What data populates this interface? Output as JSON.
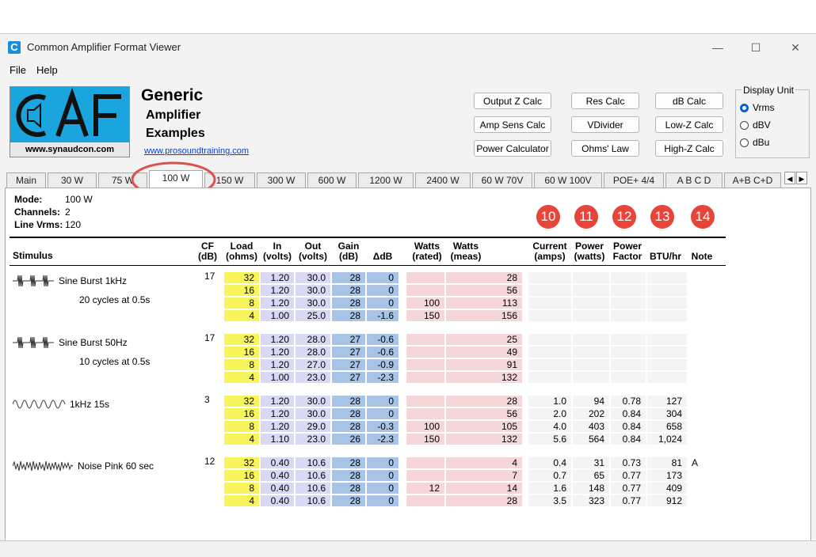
{
  "window": {
    "title": "Common Amplifier Format Viewer",
    "icon_letter": "C",
    "controls": {
      "minimize": "—",
      "maximize": "☐",
      "close": "✕"
    }
  },
  "menu": [
    "File",
    "Help"
  ],
  "logo": {
    "text": "CAF",
    "url": "www.synaudcon.com"
  },
  "brand": {
    "title": "Generic",
    "line1": "Amplifier",
    "line2": "Examples",
    "link": "www.prosoundtraining.com"
  },
  "buttons": {
    "output_z": "Output Z Calc",
    "res": "Res Calc",
    "db": "dB Calc",
    "amp_sens": "Amp Sens Calc",
    "vdivider": "VDivider",
    "low_z": "Low-Z Calc",
    "power": "Power Calculator",
    "ohms": "Ohms' Law",
    "high_z": "High-Z Calc"
  },
  "display_unit": {
    "legend": "Display Unit",
    "options": [
      "Vrms",
      "dBV",
      "dBu"
    ],
    "selected": "Vrms"
  },
  "tabs": [
    "Main",
    "30 W",
    "75 W",
    "100 W",
    "150 W",
    "300 W",
    "600 W",
    "1200 W",
    "2400 W",
    "60 W 70V",
    "60 W 100V",
    "POE+ 4/4",
    "A B C D",
    "A+B C+D"
  ],
  "active_tab": "100 W",
  "mode": {
    "mode_label": "Mode:",
    "mode_value": "100 W",
    "channels_label": "Channels:",
    "channels_value": "2",
    "line_label": "Line Vrms:",
    "line_value": "120"
  },
  "badges": [
    "10",
    "11",
    "12",
    "13",
    "14"
  ],
  "headers": {
    "stimulus": "Stimulus",
    "cf": [
      "CF",
      "(dB)"
    ],
    "load": [
      "Load",
      "(ohms)"
    ],
    "in": [
      "In",
      "(volts)"
    ],
    "out": [
      "Out",
      "(volts)"
    ],
    "gain": [
      "Gain",
      "(dB)"
    ],
    "ddb": [
      "",
      "ΔdB"
    ],
    "watts_rated": [
      "Watts",
      "(rated)"
    ],
    "watts_meas": [
      "Watts",
      "(meas)"
    ],
    "current": [
      "Current",
      "(amps)"
    ],
    "power": [
      "Power",
      "(watts)"
    ],
    "pf": [
      "Power",
      "Factor"
    ],
    "btu": [
      "",
      "BTU/hr"
    ],
    "note": [
      "",
      "Note"
    ]
  },
  "groups": [
    {
      "name": "Sine Burst 1kHz",
      "sub": "20 cycles at 0.5s",
      "wave": "burst",
      "cf": "17",
      "rows": [
        {
          "load": "32",
          "in": "1.20",
          "out": "30.0",
          "gain": "28",
          "ddb": "0",
          "rated": "",
          "meas": "28",
          "current": "",
          "power": "",
          "pf": "",
          "btu": "",
          "note": ""
        },
        {
          "load": "16",
          "in": "1.20",
          "out": "30.0",
          "gain": "28",
          "ddb": "0",
          "rated": "",
          "meas": "56",
          "current": "",
          "power": "",
          "pf": "",
          "btu": "",
          "note": ""
        },
        {
          "load": "8",
          "in": "1.20",
          "out": "30.0",
          "gain": "28",
          "ddb": "0",
          "rated": "100",
          "meas": "113",
          "current": "",
          "power": "",
          "pf": "",
          "btu": "",
          "note": ""
        },
        {
          "load": "4",
          "in": "1.00",
          "out": "25.0",
          "gain": "28",
          "ddb": "-1.6",
          "rated": "150",
          "meas": "156",
          "current": "",
          "power": "",
          "pf": "",
          "btu": "",
          "note": ""
        }
      ]
    },
    {
      "name": "Sine Burst 50Hz",
      "sub": "10 cycles at 0.5s",
      "wave": "burst",
      "cf": "17",
      "rows": [
        {
          "load": "32",
          "in": "1.20",
          "out": "28.0",
          "gain": "27",
          "ddb": "-0.6",
          "rated": "",
          "meas": "25",
          "current": "",
          "power": "",
          "pf": "",
          "btu": "",
          "note": ""
        },
        {
          "load": "16",
          "in": "1.20",
          "out": "28.0",
          "gain": "27",
          "ddb": "-0.6",
          "rated": "",
          "meas": "49",
          "current": "",
          "power": "",
          "pf": "",
          "btu": "",
          "note": ""
        },
        {
          "load": "8",
          "in": "1.20",
          "out": "27.0",
          "gain": "27",
          "ddb": "-0.9",
          "rated": "",
          "meas": "91",
          "current": "",
          "power": "",
          "pf": "",
          "btu": "",
          "note": ""
        },
        {
          "load": "4",
          "in": "1.00",
          "out": "23.0",
          "gain": "27",
          "ddb": "-2.3",
          "rated": "",
          "meas": "132",
          "current": "",
          "power": "",
          "pf": "",
          "btu": "",
          "note": ""
        }
      ]
    },
    {
      "name": "1kHz 15s",
      "sub": "",
      "wave": "sine",
      "cf": "3",
      "rows": [
        {
          "load": "32",
          "in": "1.20",
          "out": "30.0",
          "gain": "28",
          "ddb": "0",
          "rated": "",
          "meas": "28",
          "current": "1.0",
          "power": "94",
          "pf": "0.78",
          "btu": "127",
          "note": ""
        },
        {
          "load": "16",
          "in": "1.20",
          "out": "30.0",
          "gain": "28",
          "ddb": "0",
          "rated": "",
          "meas": "56",
          "current": "2.0",
          "power": "202",
          "pf": "0.84",
          "btu": "304",
          "note": ""
        },
        {
          "load": "8",
          "in": "1.20",
          "out": "29.0",
          "gain": "28",
          "ddb": "-0.3",
          "rated": "100",
          "meas": "105",
          "current": "4.0",
          "power": "403",
          "pf": "0.84",
          "btu": "658",
          "note": ""
        },
        {
          "load": "4",
          "in": "1.10",
          "out": "23.0",
          "gain": "26",
          "ddb": "-2.3",
          "rated": "150",
          "meas": "132",
          "current": "5.6",
          "power": "564",
          "pf": "0.84",
          "btu": "1,024",
          "note": ""
        }
      ]
    },
    {
      "name": "Noise Pink 60 sec",
      "sub": "",
      "wave": "noise",
      "cf": "12",
      "rows": [
        {
          "load": "32",
          "in": "0.40",
          "out": "10.6",
          "gain": "28",
          "ddb": "0",
          "rated": "",
          "meas": "4",
          "current": "0.4",
          "power": "31",
          "pf": "0.73",
          "btu": "81",
          "note": "A"
        },
        {
          "load": "16",
          "in": "0.40",
          "out": "10.6",
          "gain": "28",
          "ddb": "0",
          "rated": "",
          "meas": "7",
          "current": "0.7",
          "power": "65",
          "pf": "0.77",
          "btu": "173",
          "note": ""
        },
        {
          "load": "8",
          "in": "0.40",
          "out": "10.6",
          "gain": "28",
          "ddb": "0",
          "rated": "12",
          "meas": "14",
          "current": "1.6",
          "power": "148",
          "pf": "0.77",
          "btu": "409",
          "note": ""
        },
        {
          "load": "4",
          "in": "0.40",
          "out": "10.6",
          "gain": "28",
          "ddb": "0",
          "rated": "",
          "meas": "28",
          "current": "3.5",
          "power": "323",
          "pf": "0.77",
          "btu": "912",
          "note": ""
        }
      ]
    }
  ],
  "colors": {
    "highlight_circle": "#d9534f",
    "badge": "#e8453a",
    "load_cell": "#f8f55a",
    "in_out_cell": "#d9d9f5",
    "gain_cell": "#a7c3e6",
    "watts_cell": "#f6d7d9",
    "current_cell": "#ededed",
    "logo_bg": "#1aa5df",
    "radio_on": "#0a5fc8"
  }
}
